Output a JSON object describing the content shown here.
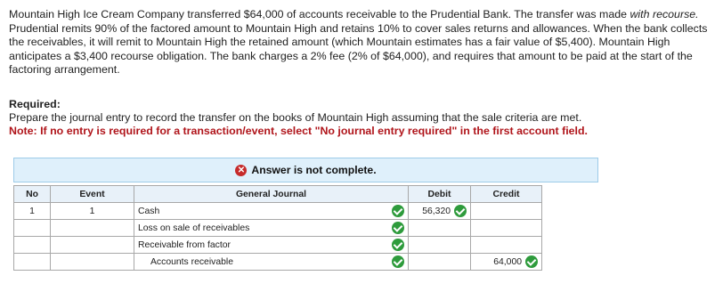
{
  "problem": {
    "part1": "Mountain High Ice Cream Company transferred $64,000 of accounts receivable to the Prudential Bank. The transfer was made ",
    "italic": "with recourse.",
    "part2": " Prudential remits 90% of the factored amount to Mountain High and retains 10% to cover sales returns and allowances. When the bank collects the receivables, it will remit to Mountain High the retained amount (which Mountain estimates has a fair value of $5,400). Mountain High anticipates a $3,400 recourse obligation. The bank charges a 2% fee (2% of $64,000), and requires that amount to be paid at the start of the factoring arrangement."
  },
  "required": {
    "heading": "Required:",
    "text": "Prepare the journal entry to record the transfer on the books of Mountain High assuming that the sale criteria are met.",
    "note": "Note: If no entry is required for a transaction/event, select \"No journal entry required\" in the first account field."
  },
  "banner": {
    "icon": "x-circle-icon",
    "text": "Answer is not complete.",
    "icon_color": "#c62b2b",
    "background": "#dff0fb"
  },
  "table": {
    "headers": {
      "no": "No",
      "event": "Event",
      "journal": "General Journal",
      "debit": "Debit",
      "credit": "Credit"
    },
    "rows": [
      {
        "no": "1",
        "event": "1",
        "account": "Cash",
        "debit": "56,320",
        "credit": ""
      },
      {
        "no": "",
        "event": "",
        "account": "Loss on sale of receivables",
        "debit": "",
        "credit": ""
      },
      {
        "no": "",
        "event": "",
        "account": "Receivable from factor",
        "debit": "",
        "credit": ""
      },
      {
        "no": "",
        "event": "",
        "account": "Accounts receivable",
        "debit": "",
        "credit": "64,000"
      }
    ],
    "check_color": "#2e9b3c"
  }
}
